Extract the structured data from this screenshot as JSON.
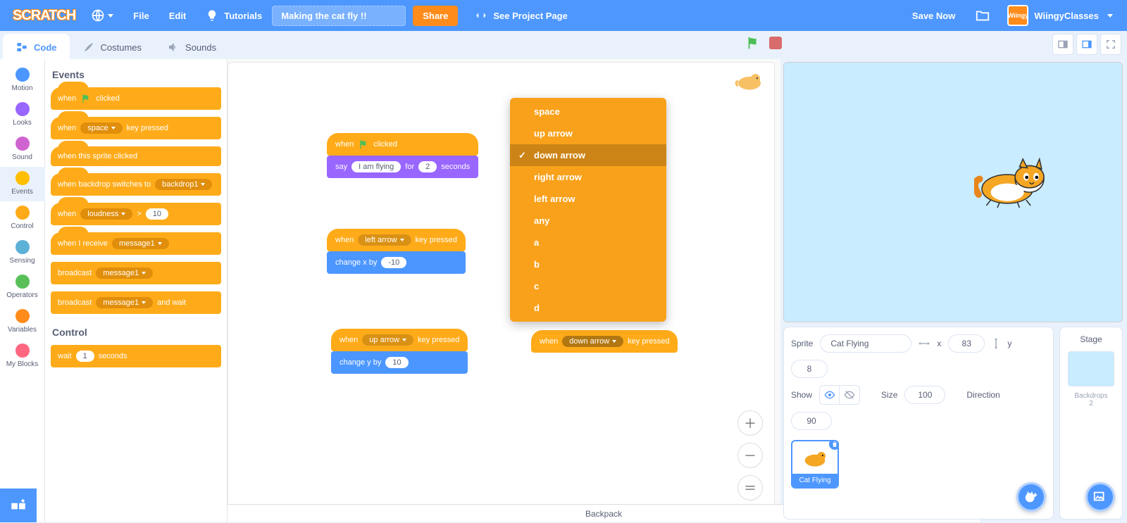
{
  "menubar": {
    "file": "File",
    "edit": "Edit",
    "tutorials": "Tutorials",
    "project_title": "Making the cat fly !!",
    "share": "Share",
    "see_project_page": "See Project Page",
    "save_now": "Save Now",
    "username": "WiingyClasses",
    "avatar_text": "Wiingy"
  },
  "tabs": {
    "code": "Code",
    "costumes": "Costumes",
    "sounds": "Sounds"
  },
  "categories": [
    {
      "name": "Motion",
      "color": "#4c97ff"
    },
    {
      "name": "Looks",
      "color": "#9966ff"
    },
    {
      "name": "Sound",
      "color": "#cf63cf"
    },
    {
      "name": "Events",
      "color": "#ffbf00",
      "selected": true
    },
    {
      "name": "Control",
      "color": "#ffab19"
    },
    {
      "name": "Sensing",
      "color": "#5cb1d6"
    },
    {
      "name": "Operators",
      "color": "#59c059"
    },
    {
      "name": "Variables",
      "color": "#ff8c1a"
    },
    {
      "name": "My Blocks",
      "color": "#ff6680"
    }
  ],
  "palette": {
    "heading_events": "Events",
    "heading_control": "Control",
    "blocks": {
      "when_flag_clicked": {
        "pre": "when",
        "post": "clicked"
      },
      "when_key_pressed": {
        "pre": "when",
        "key": "space",
        "post": "key pressed"
      },
      "when_sprite_clicked": "when this sprite clicked",
      "when_backdrop_switches": {
        "pre": "when backdrop switches to",
        "val": "backdrop1"
      },
      "when_loudness": {
        "pre": "when",
        "opt": "loudness",
        "gt": ">",
        "val": "10"
      },
      "when_receive": {
        "pre": "when I receive",
        "val": "message1"
      },
      "broadcast": {
        "pre": "broadcast",
        "val": "message1"
      },
      "broadcast_wait": {
        "pre": "broadcast",
        "val": "message1",
        "post": "and wait"
      },
      "wait": {
        "pre": "wait",
        "val": "1",
        "post": "seconds"
      }
    }
  },
  "workspace": {
    "stack1": {
      "hat": {
        "pre": "when",
        "post": "clicked"
      },
      "say": {
        "pre": "say",
        "txt": "I am flying",
        "mid": "for",
        "secs": "2",
        "post": "seconds"
      }
    },
    "stack2": {
      "hat": {
        "pre": "when",
        "key": "left arrow",
        "post": "key pressed"
      },
      "move": {
        "pre": "change x by",
        "val": "-10"
      }
    },
    "stack3": {
      "hat": {
        "pre": "when",
        "key": "up arrow",
        "post": "key pressed"
      },
      "move": {
        "pre": "change y by",
        "val": "10"
      }
    },
    "stack4": {
      "hat": {
        "pre": "when",
        "key": "down arrow",
        "post": "key pressed"
      }
    },
    "key_menu": [
      "space",
      "up arrow",
      "down arrow",
      "right arrow",
      "left arrow",
      "any",
      "a",
      "b",
      "c",
      "d"
    ],
    "key_menu_selected": "down arrow"
  },
  "sprite_info": {
    "label_sprite": "Sprite",
    "name": "Cat Flying",
    "x_label": "x",
    "x": "83",
    "y_label": "y",
    "y": "8",
    "show_label": "Show",
    "size_label": "Size",
    "size": "100",
    "direction_label": "Direction",
    "direction": "90",
    "tile_label": "Cat Flying"
  },
  "stage_panel": {
    "label": "Stage",
    "backdrops_label": "Backdrops",
    "backdrops_count": "2"
  },
  "backpack": "Backpack"
}
